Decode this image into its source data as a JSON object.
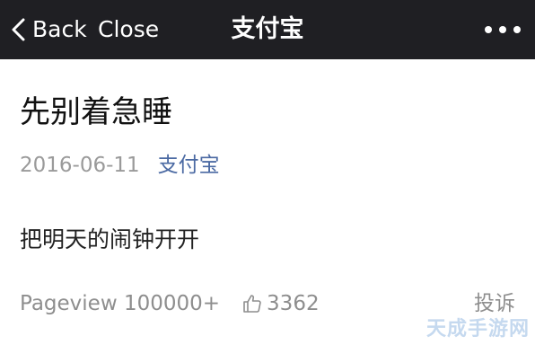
{
  "nav": {
    "back_label": "Back",
    "close_label": "Close",
    "title": "支付宝",
    "more_icon": "more-horizontal-icon"
  },
  "article": {
    "title": "先别着急睡",
    "date": "2016-06-11",
    "account": "支付宝",
    "body": "把明天的闹钟开开"
  },
  "footer": {
    "pageview_label": "Pageview",
    "pageview_count": "100000+",
    "like_icon": "thumbs-up-icon",
    "like_count": "3362",
    "report_label": "投诉"
  },
  "watermark": "天成手游网",
  "colors": {
    "navbar_bg": "#1f1f23",
    "account_link": "#4b6aa3",
    "meta_gray": "#9a9a9a"
  }
}
